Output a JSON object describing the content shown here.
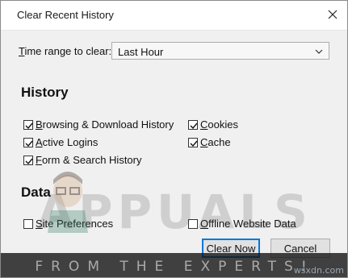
{
  "window": {
    "title": "Clear Recent History",
    "close_icon": "close-icon"
  },
  "time_range": {
    "label_prefix": "",
    "label_underline": "T",
    "label_rest": "ime range to clear:",
    "selected": "Last Hour"
  },
  "history": {
    "heading": "History",
    "items": [
      {
        "underline": "B",
        "rest": "rowsing & Download History",
        "checked": true
      },
      {
        "underline": "A",
        "rest": "ctive Logins",
        "checked": true
      },
      {
        "underline": "F",
        "rest": "orm & Search History",
        "checked": true
      },
      {
        "underline": "C",
        "rest": "ookies",
        "checked": true
      },
      {
        "underline": "C",
        "rest": "ache",
        "checked": true
      }
    ]
  },
  "data": {
    "heading": "Data",
    "items": [
      {
        "underline": "S",
        "rest": "ite Preferences",
        "checked": false
      },
      {
        "underline": "O",
        "rest": "ffline Website Data",
        "checked": false
      }
    ]
  },
  "buttons": {
    "clear_now": "Clear Now",
    "cancel": "Cancel"
  },
  "watermark": {
    "logo_text": "APPUALS",
    "tagline": "FROM THE EXPERTS!",
    "credit": "wsxdn.com"
  }
}
